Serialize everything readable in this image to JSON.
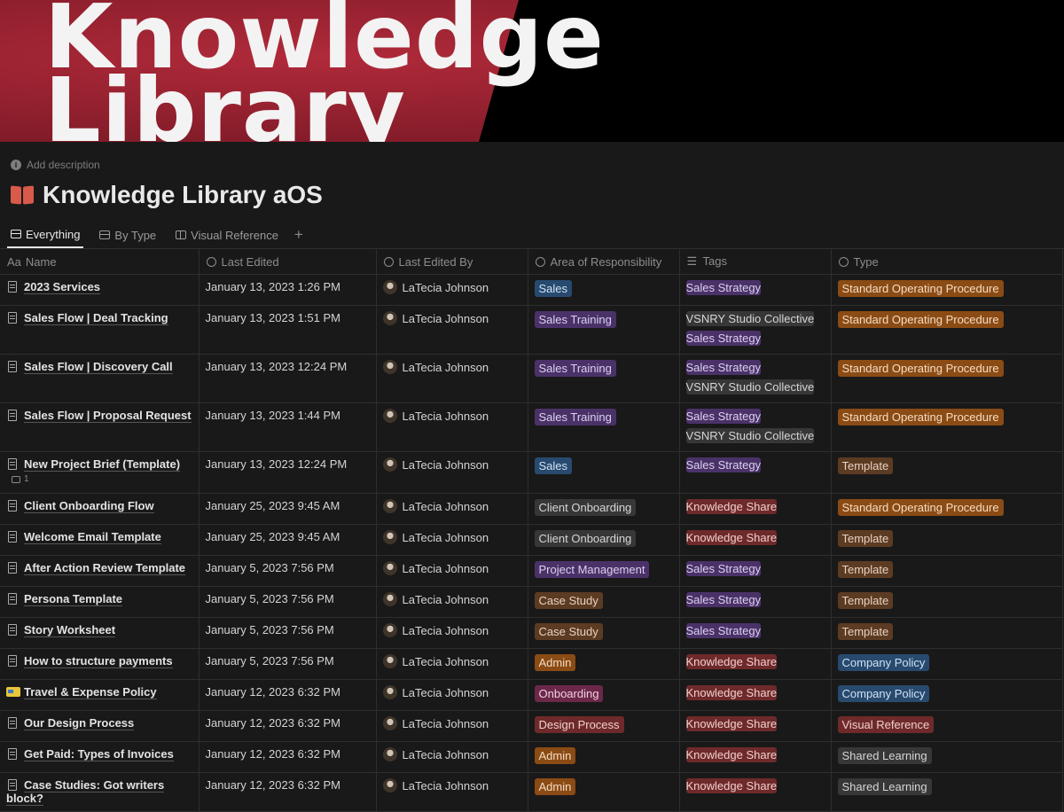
{
  "cover": {
    "line1": "Knowledge",
    "line2": "Library"
  },
  "add_description": "Add description",
  "page_title": "Knowledge Library aOS",
  "tabs": [
    {
      "label": "Everything",
      "active": true,
      "icon": "table-icon"
    },
    {
      "label": "By Type",
      "active": false,
      "icon": "table-icon"
    },
    {
      "label": "Visual Reference",
      "active": false,
      "icon": "gallery-icon"
    }
  ],
  "add_view": "+",
  "columns": [
    "Name",
    "Last Edited",
    "Last Edited By",
    "Area of Responsibility",
    "Tags",
    "Type"
  ],
  "name_column_prefix": "Aa",
  "tag_colors": {
    "blue": "#284a6e",
    "purple": "#4a3269",
    "gray": "#373737",
    "brown": "#5c3b23",
    "orange": "#8a4b14",
    "red": "#6e2a2a",
    "pink": "#6b2849"
  },
  "rows": [
    {
      "name": "2023 Services",
      "edited": "January 13, 2023 1:26 PM",
      "by": "LaTecia Johnson",
      "area": {
        "label": "Sales",
        "color": "blue"
      },
      "tags": [
        {
          "label": "Sales Strategy",
          "color": "purple"
        }
      ],
      "type": {
        "label": "Standard Operating Procedure",
        "color": "orange"
      }
    },
    {
      "name": "Sales Flow | Deal Tracking",
      "edited": "January 13, 2023 1:51 PM",
      "by": "LaTecia Johnson",
      "area": {
        "label": "Sales Training",
        "color": "purple"
      },
      "tags": [
        {
          "label": "VSNRY Studio Collective",
          "color": "gray"
        },
        {
          "label": "Sales Strategy",
          "color": "purple"
        }
      ],
      "type": {
        "label": "Standard Operating Procedure",
        "color": "orange"
      }
    },
    {
      "name": "Sales Flow | Discovery Call",
      "edited": "January 13, 2023 12:24 PM",
      "by": "LaTecia Johnson",
      "area": {
        "label": "Sales Training",
        "color": "purple"
      },
      "tags": [
        {
          "label": "Sales Strategy",
          "color": "purple"
        },
        {
          "label": "VSNRY Studio Collective",
          "color": "gray"
        }
      ],
      "type": {
        "label": "Standard Operating Procedure",
        "color": "orange"
      }
    },
    {
      "name": "Sales Flow | Proposal Request",
      "edited": "January 13, 2023 1:44 PM",
      "by": "LaTecia Johnson",
      "area": {
        "label": "Sales Training",
        "color": "purple"
      },
      "tags": [
        {
          "label": "Sales Strategy",
          "color": "purple"
        },
        {
          "label": "VSNRY Studio Collective",
          "color": "gray"
        }
      ],
      "type": {
        "label": "Standard Operating Procedure",
        "color": "orange"
      }
    },
    {
      "name": "New Project Brief (Template)",
      "edited": "January 13, 2023 12:24 PM",
      "by": "LaTecia Johnson",
      "comments": "1",
      "area": {
        "label": "Sales",
        "color": "blue"
      },
      "tags": [
        {
          "label": "Sales Strategy",
          "color": "purple"
        }
      ],
      "type": {
        "label": "Template",
        "color": "brown"
      }
    },
    {
      "name": "Client Onboarding Flow",
      "edited": "January 25, 2023 9:45 AM",
      "by": "LaTecia Johnson",
      "area": {
        "label": "Client Onboarding",
        "color": "gray"
      },
      "tags": [
        {
          "label": "Knowledge Share",
          "color": "red"
        }
      ],
      "type": {
        "label": "Standard Operating Procedure",
        "color": "orange"
      }
    },
    {
      "name": "Welcome Email Template",
      "edited": "January 25, 2023 9:45 AM",
      "by": "LaTecia Johnson",
      "area": {
        "label": "Client Onboarding",
        "color": "gray"
      },
      "tags": [
        {
          "label": "Knowledge Share",
          "color": "red"
        }
      ],
      "type": {
        "label": "Template",
        "color": "brown"
      }
    },
    {
      "name": "After Action Review Template",
      "edited": "January 5, 2023 7:56 PM",
      "by": "LaTecia Johnson",
      "area": {
        "label": "Project Management",
        "color": "purple"
      },
      "tags": [
        {
          "label": "Sales Strategy",
          "color": "purple"
        }
      ],
      "type": {
        "label": "Template",
        "color": "brown"
      }
    },
    {
      "name": "Persona Template",
      "edited": "January 5, 2023 7:56 PM",
      "by": "LaTecia Johnson",
      "area": {
        "label": "Case Study",
        "color": "brown"
      },
      "tags": [
        {
          "label": "Sales Strategy",
          "color": "purple"
        }
      ],
      "type": {
        "label": "Template",
        "color": "brown"
      }
    },
    {
      "name": "Story Worksheet",
      "edited": "January 5, 2023 7:56 PM",
      "by": "LaTecia Johnson",
      "area": {
        "label": "Case Study",
        "color": "brown"
      },
      "tags": [
        {
          "label": "Sales Strategy",
          "color": "purple"
        }
      ],
      "type": {
        "label": "Template",
        "color": "brown"
      }
    },
    {
      "name": "How to structure payments",
      "edited": "January 5, 2023 7:56 PM",
      "by": "LaTecia Johnson",
      "area": {
        "label": "Admin",
        "color": "orange"
      },
      "tags": [
        {
          "label": "Knowledge Share",
          "color": "red"
        }
      ],
      "type": {
        "label": "Company Policy",
        "color": "blue"
      }
    },
    {
      "name": "Travel & Expense Policy",
      "edited": "January 12, 2023 6:32 PM",
      "by": "LaTecia Johnson",
      "icon": "ticket-emoji-icon",
      "area": {
        "label": "Onboarding",
        "color": "pink"
      },
      "tags": [
        {
          "label": "Knowledge Share",
          "color": "red"
        }
      ],
      "type": {
        "label": "Company Policy",
        "color": "blue"
      }
    },
    {
      "name": "Our Design Process",
      "edited": "January 12, 2023 6:32 PM",
      "by": "LaTecia Johnson",
      "area": {
        "label": "Design Process",
        "color": "red"
      },
      "tags": [
        {
          "label": "Knowledge Share",
          "color": "red"
        }
      ],
      "type": {
        "label": "Visual Reference",
        "color": "red"
      }
    },
    {
      "name": "Get Paid: Types of Invoices",
      "edited": "January 12, 2023 6:32 PM",
      "by": "LaTecia Johnson",
      "area": {
        "label": "Admin",
        "color": "orange"
      },
      "tags": [
        {
          "label": "Knowledge Share",
          "color": "red"
        }
      ],
      "type": {
        "label": "Shared Learning",
        "color": "gray"
      }
    },
    {
      "name": "Case Studies: Got writers block?",
      "edited": "January 12, 2023 6:32 PM",
      "by": "LaTecia Johnson",
      "area": {
        "label": "Admin",
        "color": "orange"
      },
      "tags": [
        {
          "label": "Knowledge Share",
          "color": "red"
        }
      ],
      "type": {
        "label": "Shared Learning",
        "color": "gray"
      }
    }
  ]
}
